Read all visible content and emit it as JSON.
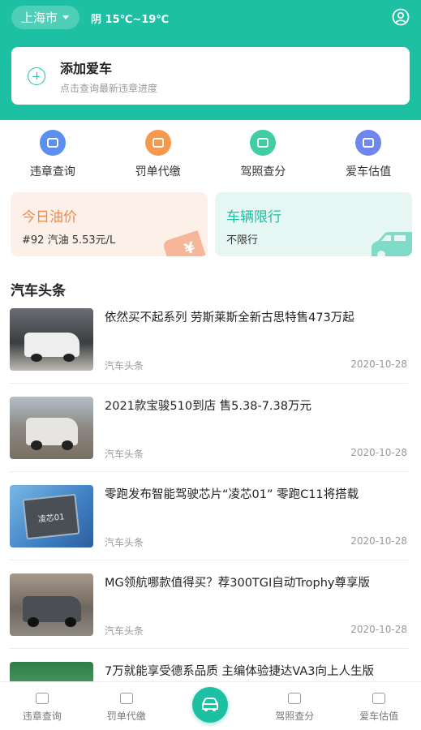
{
  "header": {
    "city": "上海市",
    "weather": "阴 15℃~19℃",
    "bg_color": "#1ec0a4"
  },
  "add_car": {
    "title": "添加爱车",
    "subtitle": "点击查询最新违章进度"
  },
  "quick_actions": [
    {
      "label": "违章查询",
      "icon": "violation-icon",
      "color": "#5b8ff0"
    },
    {
      "label": "罚单代缴",
      "icon": "ticket-icon",
      "color": "#f59a4d"
    },
    {
      "label": "驾照查分",
      "icon": "license-icon",
      "color": "#3fcda4"
    },
    {
      "label": "爱车估值",
      "icon": "car-value-icon",
      "color": "#6e86ee"
    }
  ],
  "oil_card": {
    "title": "今日油价",
    "value": "#92 汽油 5.53元/L",
    "deco": "¥"
  },
  "limit_card": {
    "title": "车辆限行",
    "value": "不限行"
  },
  "news": {
    "section_title": "汽车头条",
    "items": [
      {
        "headline": "依然买不起系列 劳斯莱斯全新古思特售473万起",
        "source": "汽车头条",
        "date": "2020-10-28"
      },
      {
        "headline": "2021款宝骏510到店 售5.38-7.38万元",
        "source": "汽车头条",
        "date": "2020-10-28"
      },
      {
        "headline": "零跑发布智能驾驶芯片“凌芯01” 零跑C11将搭载",
        "source": "汽车头条",
        "date": "2020-10-28",
        "thumb_text": "凌芯01"
      },
      {
        "headline": "MG领航哪款值得买？荐300TGI自动Trophy尊享版",
        "source": "汽车头条",
        "date": "2020-10-28"
      },
      {
        "headline": "7万就能享受德系品质 主编体验捷达VA3向上人生版",
        "source": "",
        "date": ""
      }
    ]
  },
  "tabbar": {
    "tabs": [
      {
        "label": "违章查询",
        "icon": "violation-tab-icon"
      },
      {
        "label": "罚单代缴",
        "icon": "ticket-tab-icon"
      },
      {
        "label": "",
        "icon": "car-home-icon"
      },
      {
        "label": "驾照查分",
        "icon": "license-tab-icon"
      },
      {
        "label": "爱车估值",
        "icon": "car-value-tab-icon"
      }
    ]
  }
}
